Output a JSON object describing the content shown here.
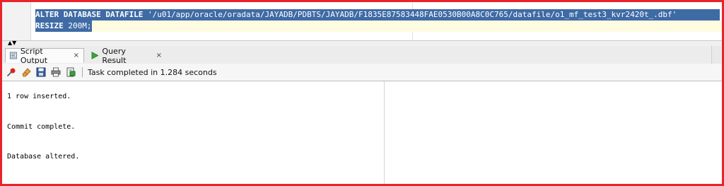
{
  "editor": {
    "line1_keyword": "ALTER DATABASE DATAFILE",
    "line1_path": " '/u01/app/oracle/oradata/JAYADB/PDBTS/JAYADB/F1835E87583448FAE0530B00A8C0C765/datafile/o1_mf_test3_kvr2420t_.dbf'",
    "line2_keyword": "RESIZE",
    "line2_value": " 200M;"
  },
  "tabs": [
    {
      "label": "Script Output",
      "icon": "script-output-icon"
    },
    {
      "label": "Query Result",
      "icon": "play-icon"
    }
  ],
  "tab_close": "×",
  "toolbar": {
    "icons": [
      "pin-icon",
      "eraser-icon",
      "save-icon",
      "print-icon",
      "export-icon"
    ],
    "status": "Task completed in 1.284 seconds"
  },
  "output": {
    "lines": [
      "1 row inserted.",
      "Commit complete.",
      "Database altered."
    ]
  },
  "colors": {
    "selection": "#3f6ba5",
    "frame_border": "#e8232a"
  }
}
